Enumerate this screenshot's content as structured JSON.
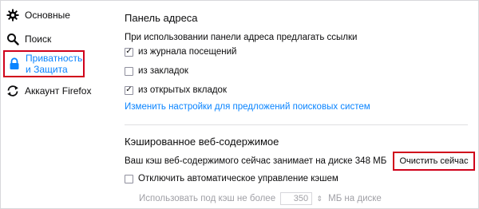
{
  "sidebar": {
    "items": [
      {
        "label": "Основные",
        "icon": "gear-icon"
      },
      {
        "label": "Поиск",
        "icon": "search-icon"
      },
      {
        "label": "Приватность и Защита",
        "icon": "lock-icon",
        "selected": true
      },
      {
        "label": "Аккаунт Firefox",
        "icon": "sync-icon"
      }
    ]
  },
  "address_bar": {
    "heading": "Панель адреса",
    "description": "При использовании панели адреса предлагать ссылки",
    "options": [
      {
        "label": "из журнала посещений",
        "checked": true
      },
      {
        "label": "из закладок",
        "checked": false
      },
      {
        "label": "из открытых вкладок",
        "checked": true
      }
    ],
    "link": "Изменить настройки для предложений поисковых систем"
  },
  "cache": {
    "heading": "Кэшированное веб-содержимое",
    "usage_text": "Ваш кэш веб-содержимого сейчас занимает на диске 348 МБ",
    "clear_button": "Очистить сейчас",
    "override_label": "Отключить автоматическое управление кэшем",
    "override_checked": false,
    "limit_prefix": "Использовать под кэш не более",
    "limit_value": "350",
    "limit_suffix": "МБ на диске"
  },
  "colors": {
    "accent": "#0a84ff",
    "highlight_border": "#d0021b"
  }
}
